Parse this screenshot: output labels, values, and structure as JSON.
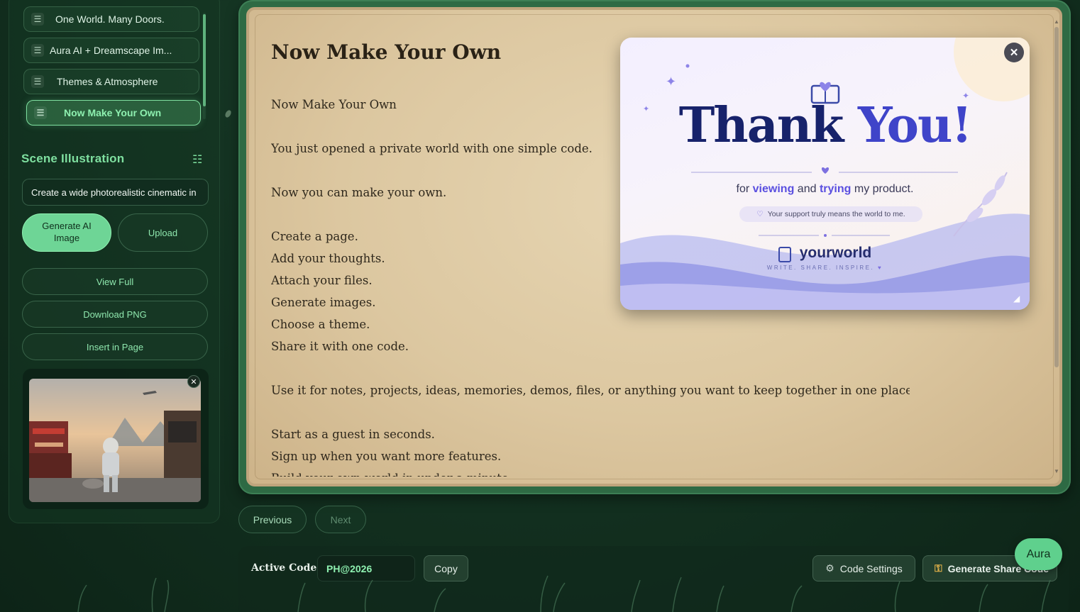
{
  "sidebar": {
    "pages": [
      {
        "label": "One World. Many Doors."
      },
      {
        "label": "Aura AI + Dreamscape Im..."
      },
      {
        "label": "Themes & Atmosphere"
      },
      {
        "label": "Now Make Your Own",
        "active": true
      }
    ],
    "scene_title": "Scene Illustration",
    "prompt_value": "Create a wide photorealistic cinematic in",
    "generate_label_line1": "Generate AI",
    "generate_label_line2": "Image",
    "upload_label": "Upload",
    "view_full_label": "View Full",
    "download_label": "Download PNG",
    "insert_label": "Insert in Page"
  },
  "document": {
    "title": "Now Make Your Own",
    "lines": [
      "Now Make Your Own",
      "",
      "You just opened a private world with one simple code.",
      "",
      "Now you can make your own.",
      "",
      "Create a page.",
      "Add your thoughts.",
      "Attach your files.",
      "Generate images.",
      "Choose a theme.",
      "Share it with one code.",
      "",
      "Use it for notes, projects, ideas, memories, demos, files, or anything you want to keep together in one place.",
      "",
      "Start as a guest in seconds.",
      "Sign up when you want more features.",
      "Build your own world in under a minute."
    ]
  },
  "card": {
    "thank": "Thank",
    "you": "You!",
    "sub_for": "for",
    "sub_viewing": "viewing",
    "sub_and": "and",
    "sub_trying": "trying",
    "sub_rest": "my product.",
    "support": "Your support truly means the world to me.",
    "brand": "yourworld",
    "tagline": "WRITE. SHARE. INSPIRE."
  },
  "nav": {
    "previous": "Previous",
    "next": "Next"
  },
  "bottom": {
    "active_code_label": "Active Code:",
    "active_code_value": "PH@2026",
    "copy_label": "Copy",
    "code_settings_label": "Code Settings",
    "share_label": "Generate Share Code",
    "aura_label": "Aura"
  },
  "colors": {
    "accent": "#7fe0a0",
    "paper": "#e0cfad",
    "frame": "#2e6a44",
    "thank_dark": "#17226b",
    "thank_blue": "#3f44c9"
  }
}
